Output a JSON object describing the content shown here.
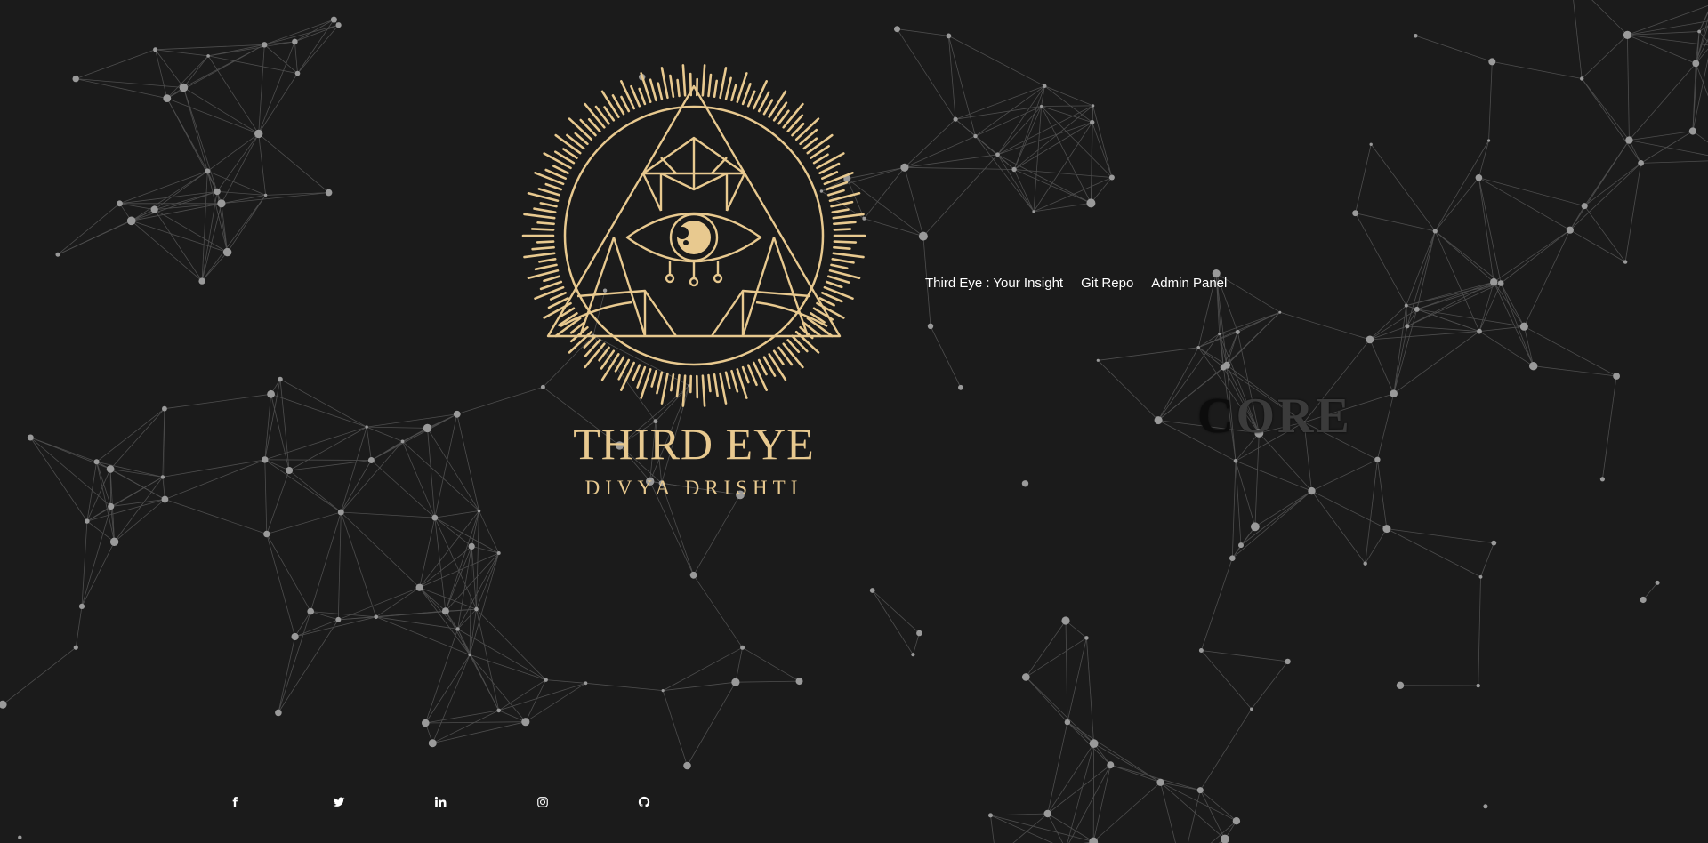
{
  "brand": {
    "title": "THIRD EYE",
    "subtitle": "DIVYA DRISHTI",
    "gold_color": "#e8c98f"
  },
  "nav": {
    "links": [
      {
        "label": "Third Eye : Your Insight"
      },
      {
        "label": "Git Repo"
      },
      {
        "label": "Admin Panel"
      }
    ]
  },
  "core": {
    "first_letter": "C",
    "rest": "ORE"
  },
  "social": [
    {
      "icon": "facebook-icon"
    },
    {
      "icon": "twitter-icon"
    },
    {
      "icon": "linkedin-icon"
    },
    {
      "icon": "instagram-icon"
    },
    {
      "icon": "github-icon"
    }
  ],
  "colors": {
    "background": "#1b1b1b",
    "network_line": "#8a8a8a",
    "network_node": "#9a9a9a",
    "nav_text": "#ffffff",
    "core_text": "#3b3b3b"
  }
}
